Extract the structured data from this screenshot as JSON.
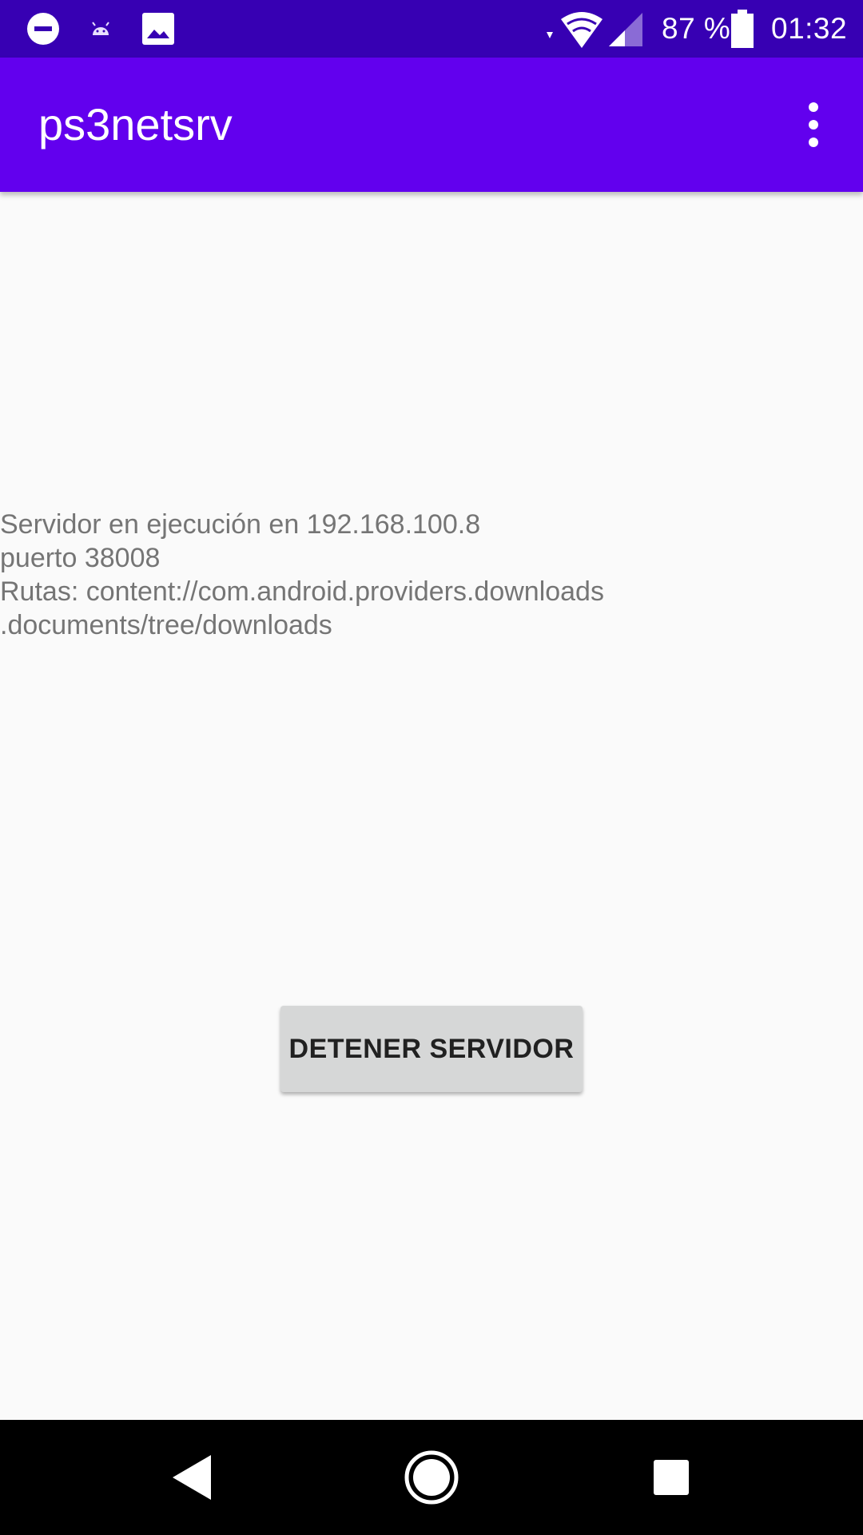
{
  "status_bar": {
    "battery_text": "87 %",
    "time": "01:32",
    "icons": [
      "do-not-disturb-icon",
      "android-debug-icon",
      "image-icon",
      "wifi-icon",
      "cell-signal-icon",
      "battery-icon"
    ]
  },
  "app_bar": {
    "title": "ps3netsrv",
    "menu_icon": "more-vert-icon"
  },
  "main": {
    "info_lines": [
      "Servidor en ejecución en 192.168.100.8",
      "puerto 38008",
      "Rutas: content://com.android.providers.downloads",
      ".documents/tree/downloads"
    ],
    "button_label": "DETENER SERVIDOR"
  },
  "nav_bar": {
    "icons": [
      "back-icon",
      "home-icon",
      "recents-icon"
    ]
  },
  "colors": {
    "status_bar": "#3700b3",
    "app_bar": "#6200ee",
    "background": "#fafafa",
    "button": "#d6d7d7",
    "text": "#757575"
  }
}
